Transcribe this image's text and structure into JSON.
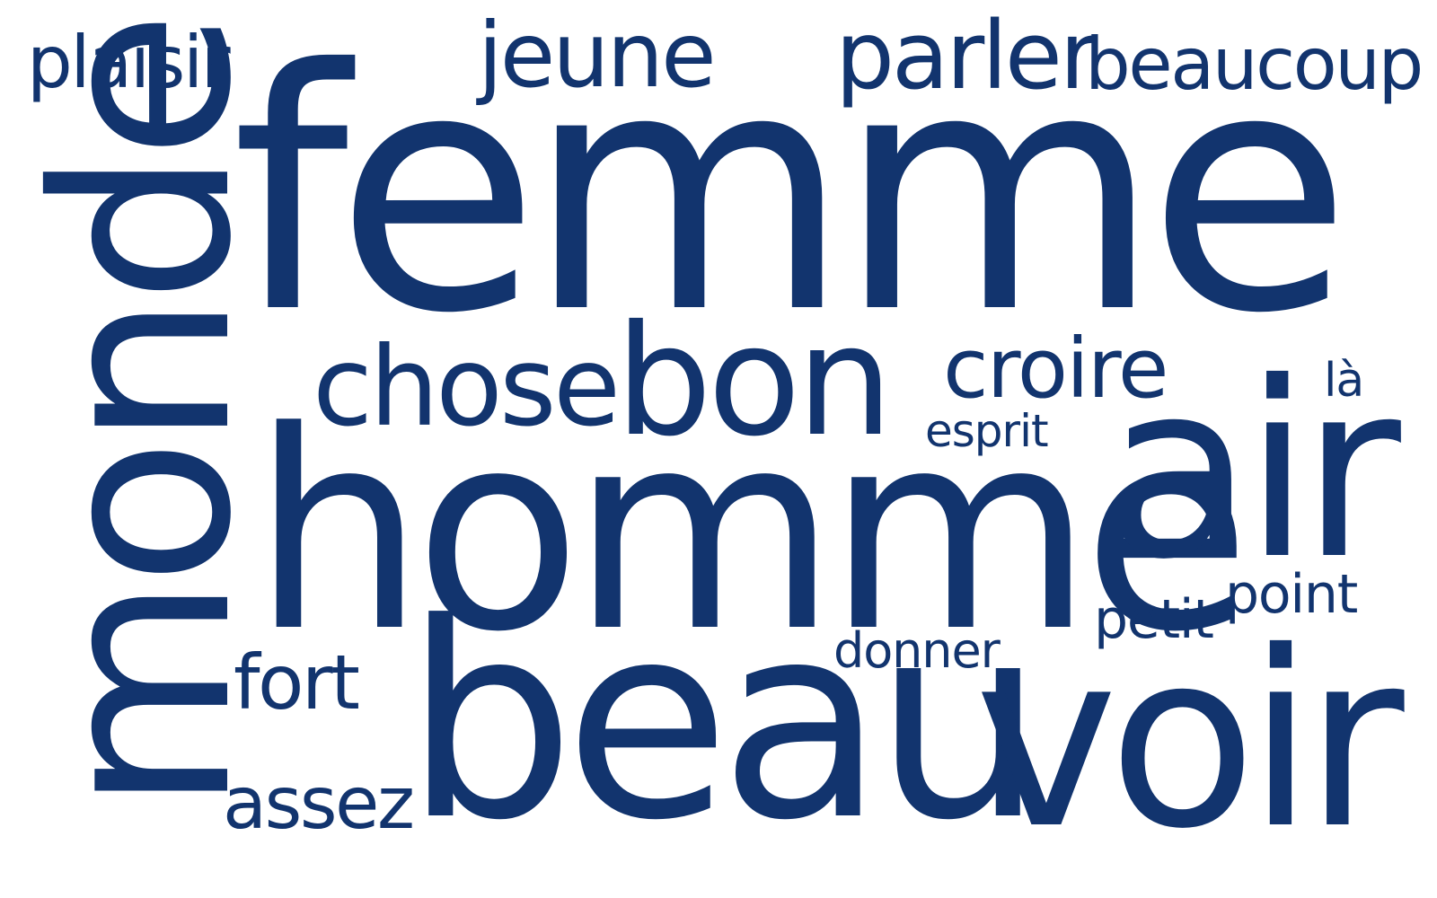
{
  "cloud": {
    "color": "#12346e",
    "words": {
      "femme": "femme",
      "homme": "homme",
      "monde": "monde",
      "beau": "beau",
      "voir": "voir",
      "air": "air",
      "bon": "bon",
      "chose": "chose",
      "croire": "croire",
      "parler": "parler",
      "jeune": "jeune",
      "beaucoup": "beaucoup",
      "plaisir": "plaisir",
      "fort": "fort",
      "assez": "assez",
      "donner": "donner",
      "petit": "petit",
      "point": "point",
      "esprit": "esprit",
      "la": "là"
    }
  }
}
